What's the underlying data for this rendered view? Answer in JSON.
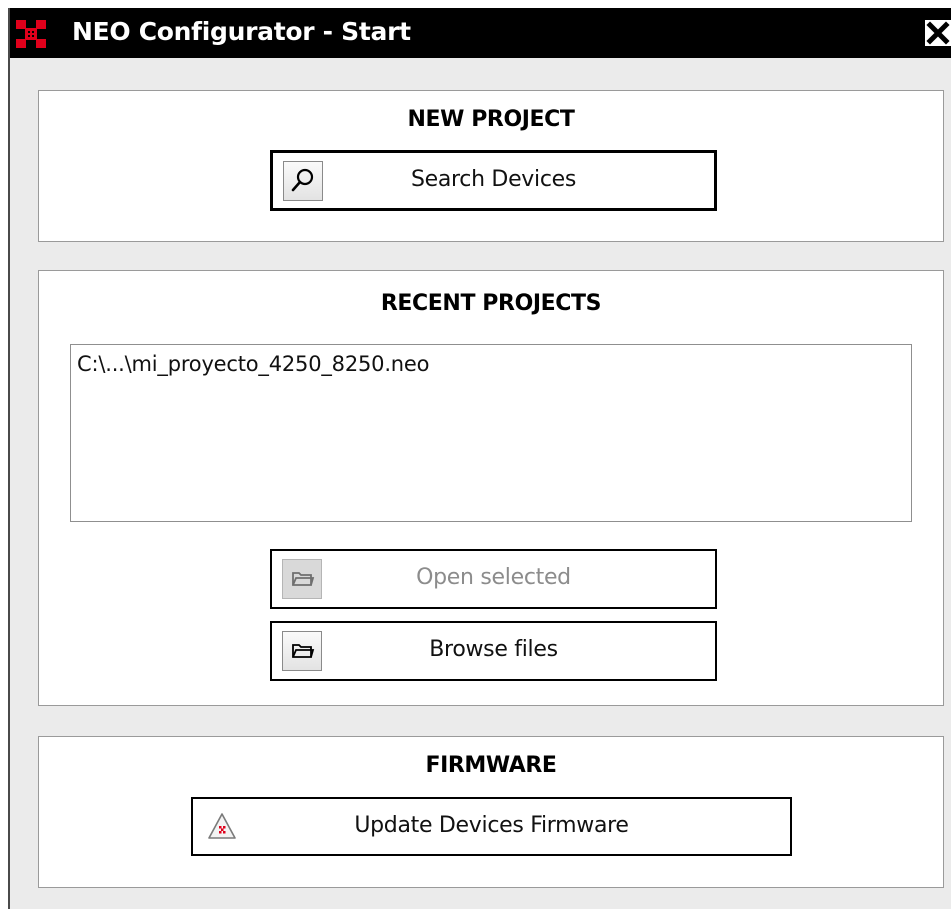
{
  "window": {
    "title": "NEO Configurator - Start",
    "close_icon": "close-icon",
    "app_icon": "neo-logo-icon"
  },
  "new_project": {
    "title": "NEW PROJECT",
    "search_button_label": "Search Devices",
    "search_icon": "magnifier-icon"
  },
  "recent_projects": {
    "title": "RECENT PROJECTS",
    "items": [
      "C:\\...\\mi_proyecto_4250_8250.neo"
    ],
    "open_selected_label": "Open selected",
    "open_selected_enabled": false,
    "browse_files_label": "Browse files",
    "folder_icon": "folder-icon"
  },
  "firmware": {
    "title": "FIRMWARE",
    "update_button_label": "Update Devices Firmware",
    "update_icon": "warning-triangle-icon"
  },
  "colors": {
    "titlebar": "#000000",
    "window_background": "#ebebeb",
    "panel_background": "#ffffff",
    "logo_red": "#e0001b",
    "disabled_text": "#8c8c8c"
  }
}
